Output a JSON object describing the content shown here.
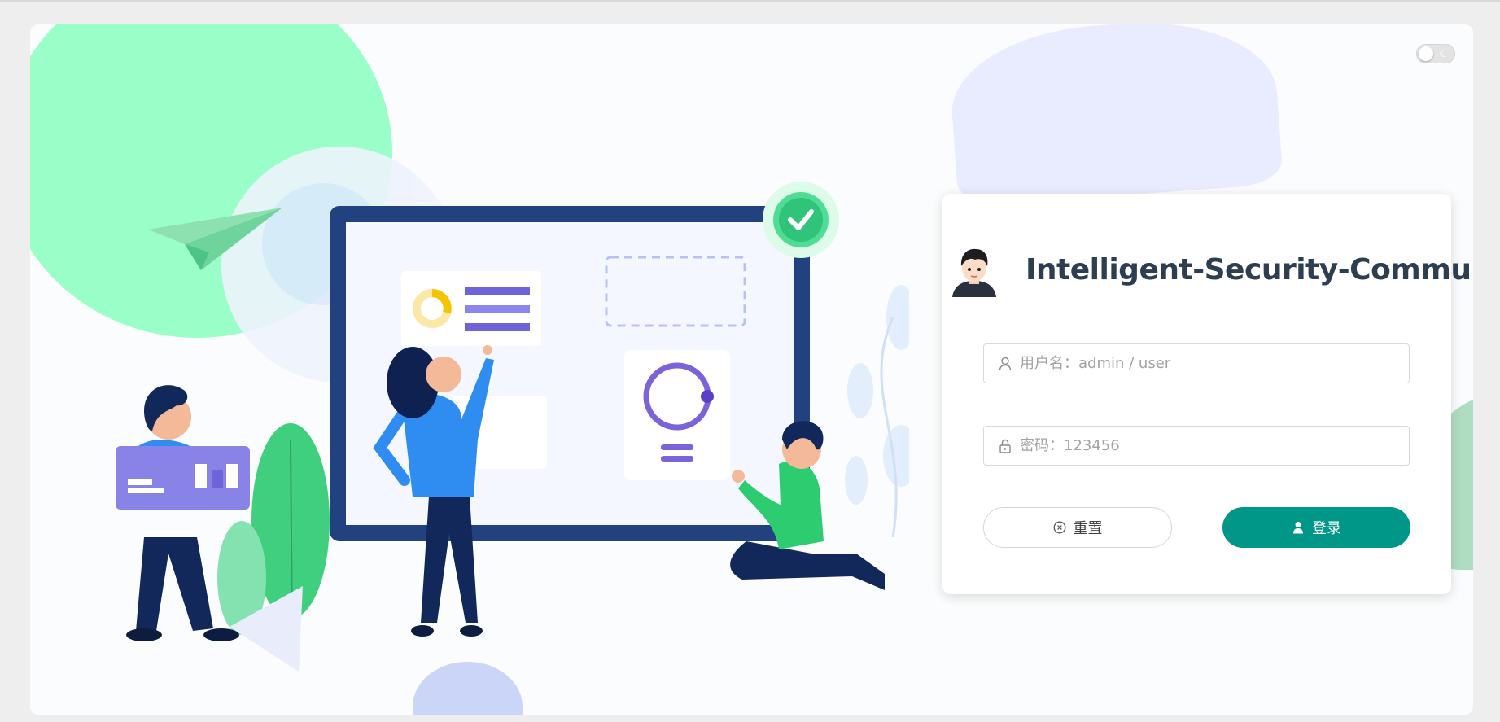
{
  "app": {
    "title": "Intelligent-Security-Community"
  },
  "theme_toggle": {
    "icon": "moon-icon",
    "state": "off"
  },
  "login": {
    "username_placeholder": "用户名：admin / user",
    "username_value": "",
    "password_placeholder": "密码：123456",
    "password_value": "",
    "reset_label": "重置",
    "login_label": "登录"
  },
  "icons": {
    "username": "user-outline-icon",
    "password": "lock-icon",
    "reset": "close-circle-icon",
    "login": "user-filled-icon"
  },
  "colors": {
    "primary": "#009688",
    "title": "#2c3e50",
    "accent_green": "#2ecc71",
    "accent_blue": "#2f55e8"
  }
}
